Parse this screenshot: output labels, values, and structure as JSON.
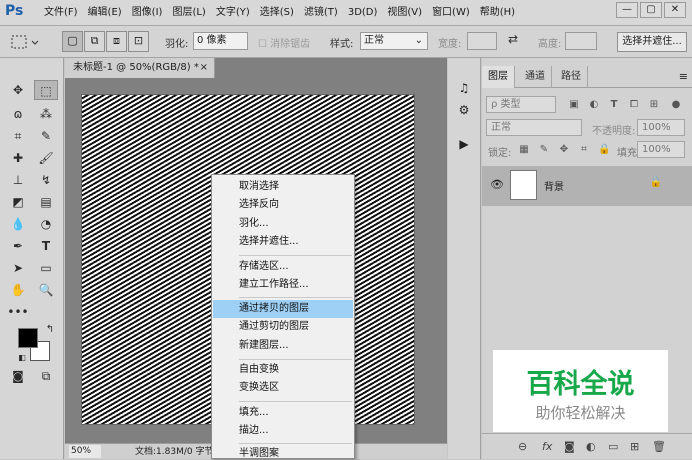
{
  "app": {
    "logo": "Ps"
  },
  "menu": [
    "文件(F)",
    "编辑(E)",
    "图像(I)",
    "图层(L)",
    "文字(Y)",
    "选择(S)",
    "滤镜(T)",
    "3D(D)",
    "视图(V)",
    "窗口(W)",
    "帮助(H)"
  ],
  "window_controls": {
    "minimize": "—",
    "restore": "▢",
    "close": "✕"
  },
  "options": {
    "feather_label": "羽化:",
    "feather_value": "0 像素",
    "antialias_label": "消除锯齿",
    "style_label": "样式:",
    "style_value": "正常",
    "width_label": "宽度:",
    "height_label": "高度:",
    "refine_button": "选择并遮住..."
  },
  "document": {
    "tab_title": "未标题-1 @ 50%(RGB/8) *",
    "tab_close": "×",
    "zoom": "50%",
    "doc_info": "文档:1.83M/0 字节"
  },
  "context_menu": {
    "items": [
      {
        "label": "取消选择"
      },
      {
        "label": "选择反向"
      },
      {
        "label": "羽化..."
      },
      {
        "label": "选择并遮住..."
      },
      {
        "label": "存储选区..."
      },
      {
        "label": "建立工作路径..."
      },
      {
        "label": "通过拷贝的图层",
        "highlighted": true
      },
      {
        "label": "通过剪切的图层"
      },
      {
        "label": "新建图层..."
      },
      {
        "label": "自由变换"
      },
      {
        "label": "变换选区"
      },
      {
        "label": "填充..."
      },
      {
        "label": "描边..."
      },
      {
        "label": "半调图案"
      }
    ]
  },
  "layers_panel": {
    "tabs": [
      "图层",
      "通道",
      "路径"
    ],
    "filter_label": "ρ 类型",
    "blend_mode": "正常",
    "opacity_label": "不透明度:",
    "opacity_value": "100%",
    "lock_label": "锁定:",
    "fill_label": "填充:",
    "fill_value": "100%",
    "layer_name": "背景"
  },
  "watermark": {
    "title": "百科全说",
    "subtitle": "助你轻松解决"
  },
  "colors": {
    "highlight": "#9ed0f5",
    "watermark_green": "#17a84a",
    "ps_blue": "#1f5fa8"
  }
}
